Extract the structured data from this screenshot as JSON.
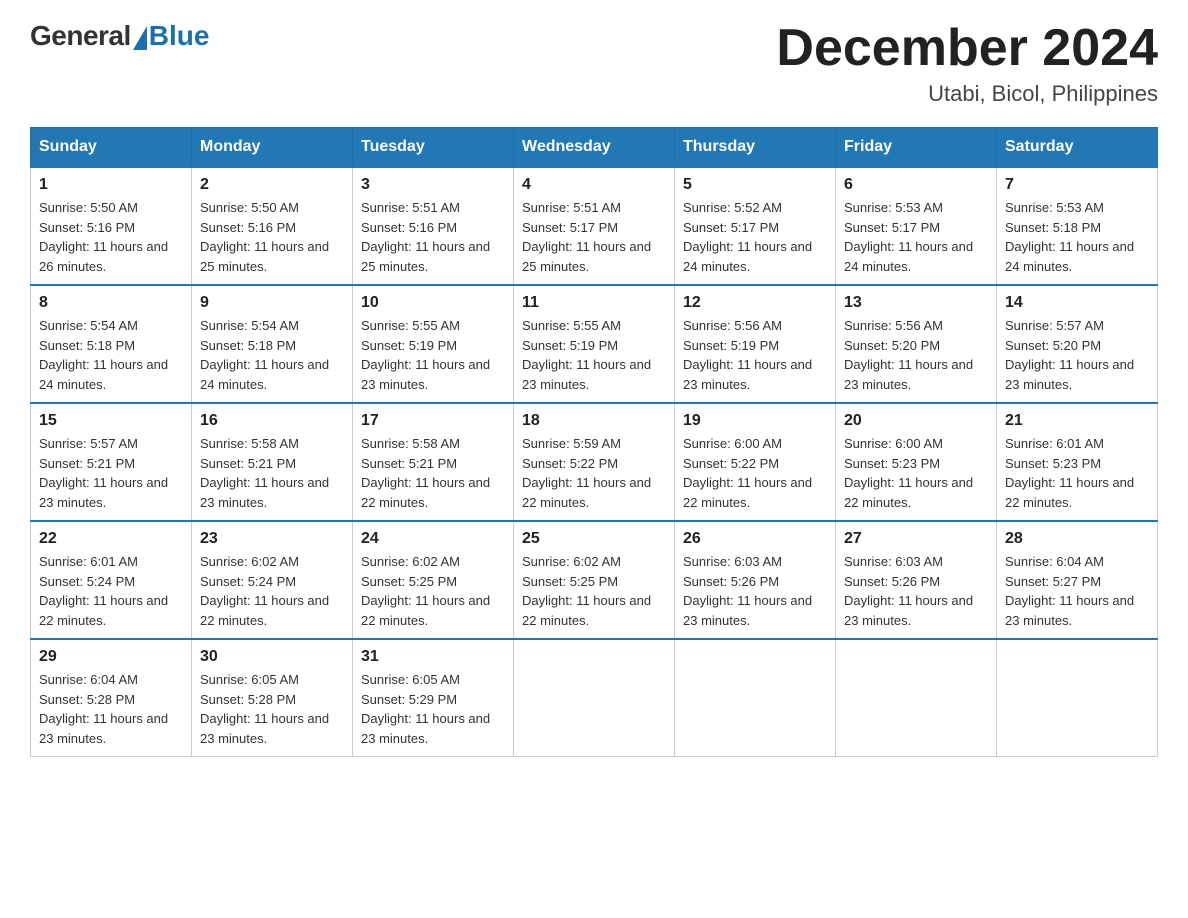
{
  "header": {
    "logo_general": "General",
    "logo_blue": "Blue",
    "month_title": "December 2024",
    "location": "Utabi, Bicol, Philippines"
  },
  "days_of_week": [
    "Sunday",
    "Monday",
    "Tuesday",
    "Wednesday",
    "Thursday",
    "Friday",
    "Saturday"
  ],
  "weeks": [
    [
      {
        "day": "1",
        "sunrise": "5:50 AM",
        "sunset": "5:16 PM",
        "daylight": "11 hours and 26 minutes."
      },
      {
        "day": "2",
        "sunrise": "5:50 AM",
        "sunset": "5:16 PM",
        "daylight": "11 hours and 25 minutes."
      },
      {
        "day": "3",
        "sunrise": "5:51 AM",
        "sunset": "5:16 PM",
        "daylight": "11 hours and 25 minutes."
      },
      {
        "day": "4",
        "sunrise": "5:51 AM",
        "sunset": "5:17 PM",
        "daylight": "11 hours and 25 minutes."
      },
      {
        "day": "5",
        "sunrise": "5:52 AM",
        "sunset": "5:17 PM",
        "daylight": "11 hours and 24 minutes."
      },
      {
        "day": "6",
        "sunrise": "5:53 AM",
        "sunset": "5:17 PM",
        "daylight": "11 hours and 24 minutes."
      },
      {
        "day": "7",
        "sunrise": "5:53 AM",
        "sunset": "5:18 PM",
        "daylight": "11 hours and 24 minutes."
      }
    ],
    [
      {
        "day": "8",
        "sunrise": "5:54 AM",
        "sunset": "5:18 PM",
        "daylight": "11 hours and 24 minutes."
      },
      {
        "day": "9",
        "sunrise": "5:54 AM",
        "sunset": "5:18 PM",
        "daylight": "11 hours and 24 minutes."
      },
      {
        "day": "10",
        "sunrise": "5:55 AM",
        "sunset": "5:19 PM",
        "daylight": "11 hours and 23 minutes."
      },
      {
        "day": "11",
        "sunrise": "5:55 AM",
        "sunset": "5:19 PM",
        "daylight": "11 hours and 23 minutes."
      },
      {
        "day": "12",
        "sunrise": "5:56 AM",
        "sunset": "5:19 PM",
        "daylight": "11 hours and 23 minutes."
      },
      {
        "day": "13",
        "sunrise": "5:56 AM",
        "sunset": "5:20 PM",
        "daylight": "11 hours and 23 minutes."
      },
      {
        "day": "14",
        "sunrise": "5:57 AM",
        "sunset": "5:20 PM",
        "daylight": "11 hours and 23 minutes."
      }
    ],
    [
      {
        "day": "15",
        "sunrise": "5:57 AM",
        "sunset": "5:21 PM",
        "daylight": "11 hours and 23 minutes."
      },
      {
        "day": "16",
        "sunrise": "5:58 AM",
        "sunset": "5:21 PM",
        "daylight": "11 hours and 23 minutes."
      },
      {
        "day": "17",
        "sunrise": "5:58 AM",
        "sunset": "5:21 PM",
        "daylight": "11 hours and 22 minutes."
      },
      {
        "day": "18",
        "sunrise": "5:59 AM",
        "sunset": "5:22 PM",
        "daylight": "11 hours and 22 minutes."
      },
      {
        "day": "19",
        "sunrise": "6:00 AM",
        "sunset": "5:22 PM",
        "daylight": "11 hours and 22 minutes."
      },
      {
        "day": "20",
        "sunrise": "6:00 AM",
        "sunset": "5:23 PM",
        "daylight": "11 hours and 22 minutes."
      },
      {
        "day": "21",
        "sunrise": "6:01 AM",
        "sunset": "5:23 PM",
        "daylight": "11 hours and 22 minutes."
      }
    ],
    [
      {
        "day": "22",
        "sunrise": "6:01 AM",
        "sunset": "5:24 PM",
        "daylight": "11 hours and 22 minutes."
      },
      {
        "day": "23",
        "sunrise": "6:02 AM",
        "sunset": "5:24 PM",
        "daylight": "11 hours and 22 minutes."
      },
      {
        "day": "24",
        "sunrise": "6:02 AM",
        "sunset": "5:25 PM",
        "daylight": "11 hours and 22 minutes."
      },
      {
        "day": "25",
        "sunrise": "6:02 AM",
        "sunset": "5:25 PM",
        "daylight": "11 hours and 22 minutes."
      },
      {
        "day": "26",
        "sunrise": "6:03 AM",
        "sunset": "5:26 PM",
        "daylight": "11 hours and 23 minutes."
      },
      {
        "day": "27",
        "sunrise": "6:03 AM",
        "sunset": "5:26 PM",
        "daylight": "11 hours and 23 minutes."
      },
      {
        "day": "28",
        "sunrise": "6:04 AM",
        "sunset": "5:27 PM",
        "daylight": "11 hours and 23 minutes."
      }
    ],
    [
      {
        "day": "29",
        "sunrise": "6:04 AM",
        "sunset": "5:28 PM",
        "daylight": "11 hours and 23 minutes."
      },
      {
        "day": "30",
        "sunrise": "6:05 AM",
        "sunset": "5:28 PM",
        "daylight": "11 hours and 23 minutes."
      },
      {
        "day": "31",
        "sunrise": "6:05 AM",
        "sunset": "5:29 PM",
        "daylight": "11 hours and 23 minutes."
      },
      null,
      null,
      null,
      null
    ]
  ]
}
